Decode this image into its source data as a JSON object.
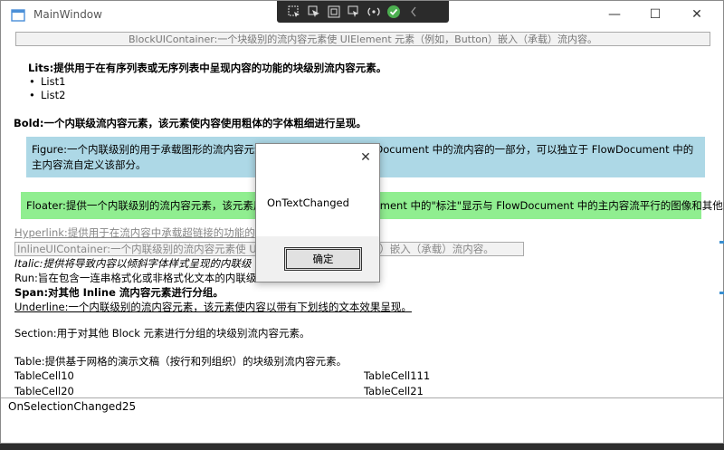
{
  "window": {
    "title": "MainWindow",
    "minimize": "—",
    "maximize": "☐",
    "close": "✕"
  },
  "toolbar": {
    "icons": [
      "select-element-icon",
      "cursor-icon",
      "layout-icon",
      "pointer-select-icon",
      "hot-reload-icon",
      "check-icon",
      "collapse-icon"
    ]
  },
  "content": {
    "block_ui": "BlockUIContainer:一个块级别的流内容元素使 UIElement 元素（例如，Button）嵌入（承载）流内容。",
    "list_title": "Lits:提供用于在有序列表或无序列表中呈现内容的功能的块级别流内容元素。",
    "list_items": [
      "List1",
      "List2"
    ],
    "bold": "Bold:一个内联级流内容元素，该元素使内容使用粗体的字体粗细进行呈现。",
    "figure": "Figure:一个内联级别的用于承载图形的流内容元素，这些图形可作为 FlowDocument 中的流内容的一部分，可以独立于 FlowDocument 中的主内容流自定义该部分。",
    "floater": "Floater:提供一个内联级别的流内容元素，该元素用于承载定位于 FlowDocument 中的\"标注\"显示与 FlowDocument 中的主内容流平行的图像和其他内容。",
    "hyperlink": "Hyperlink:提供用于在流内容中承载超链接的功能的",
    "inline_ui": "InlineUIContainer:一个内联级别的流内容元素使 UIElement（例如，Button）嵌入（承载）流内容。",
    "italic": "Italic:提供将导致内容以倾斜字体样式呈现的内联级",
    "run": "Run:旨在包含一连串格式化或非格式化文本的内联级",
    "span": "Span:对其他 Inline 流内容元素进行分组。",
    "underline": "Underline:一个内联级别的流内容元素，该元素使内容以带有下划线的文本效果呈现。",
    "section": "Section:用于对其他 Block 元素进行分组的块级别流内容元素。",
    "table_title": "Table:提供基于网格的演示文稿（按行和列组织）的块级别流内容元素。",
    "table_rows": [
      [
        "TableCell10",
        "TableCell111"
      ],
      [
        "TableCell20",
        "TableCell21"
      ]
    ]
  },
  "status": "OnSelectionChanged25",
  "dialog": {
    "message": "OnTextChanged",
    "ok_label": "确定",
    "close": "✕"
  }
}
